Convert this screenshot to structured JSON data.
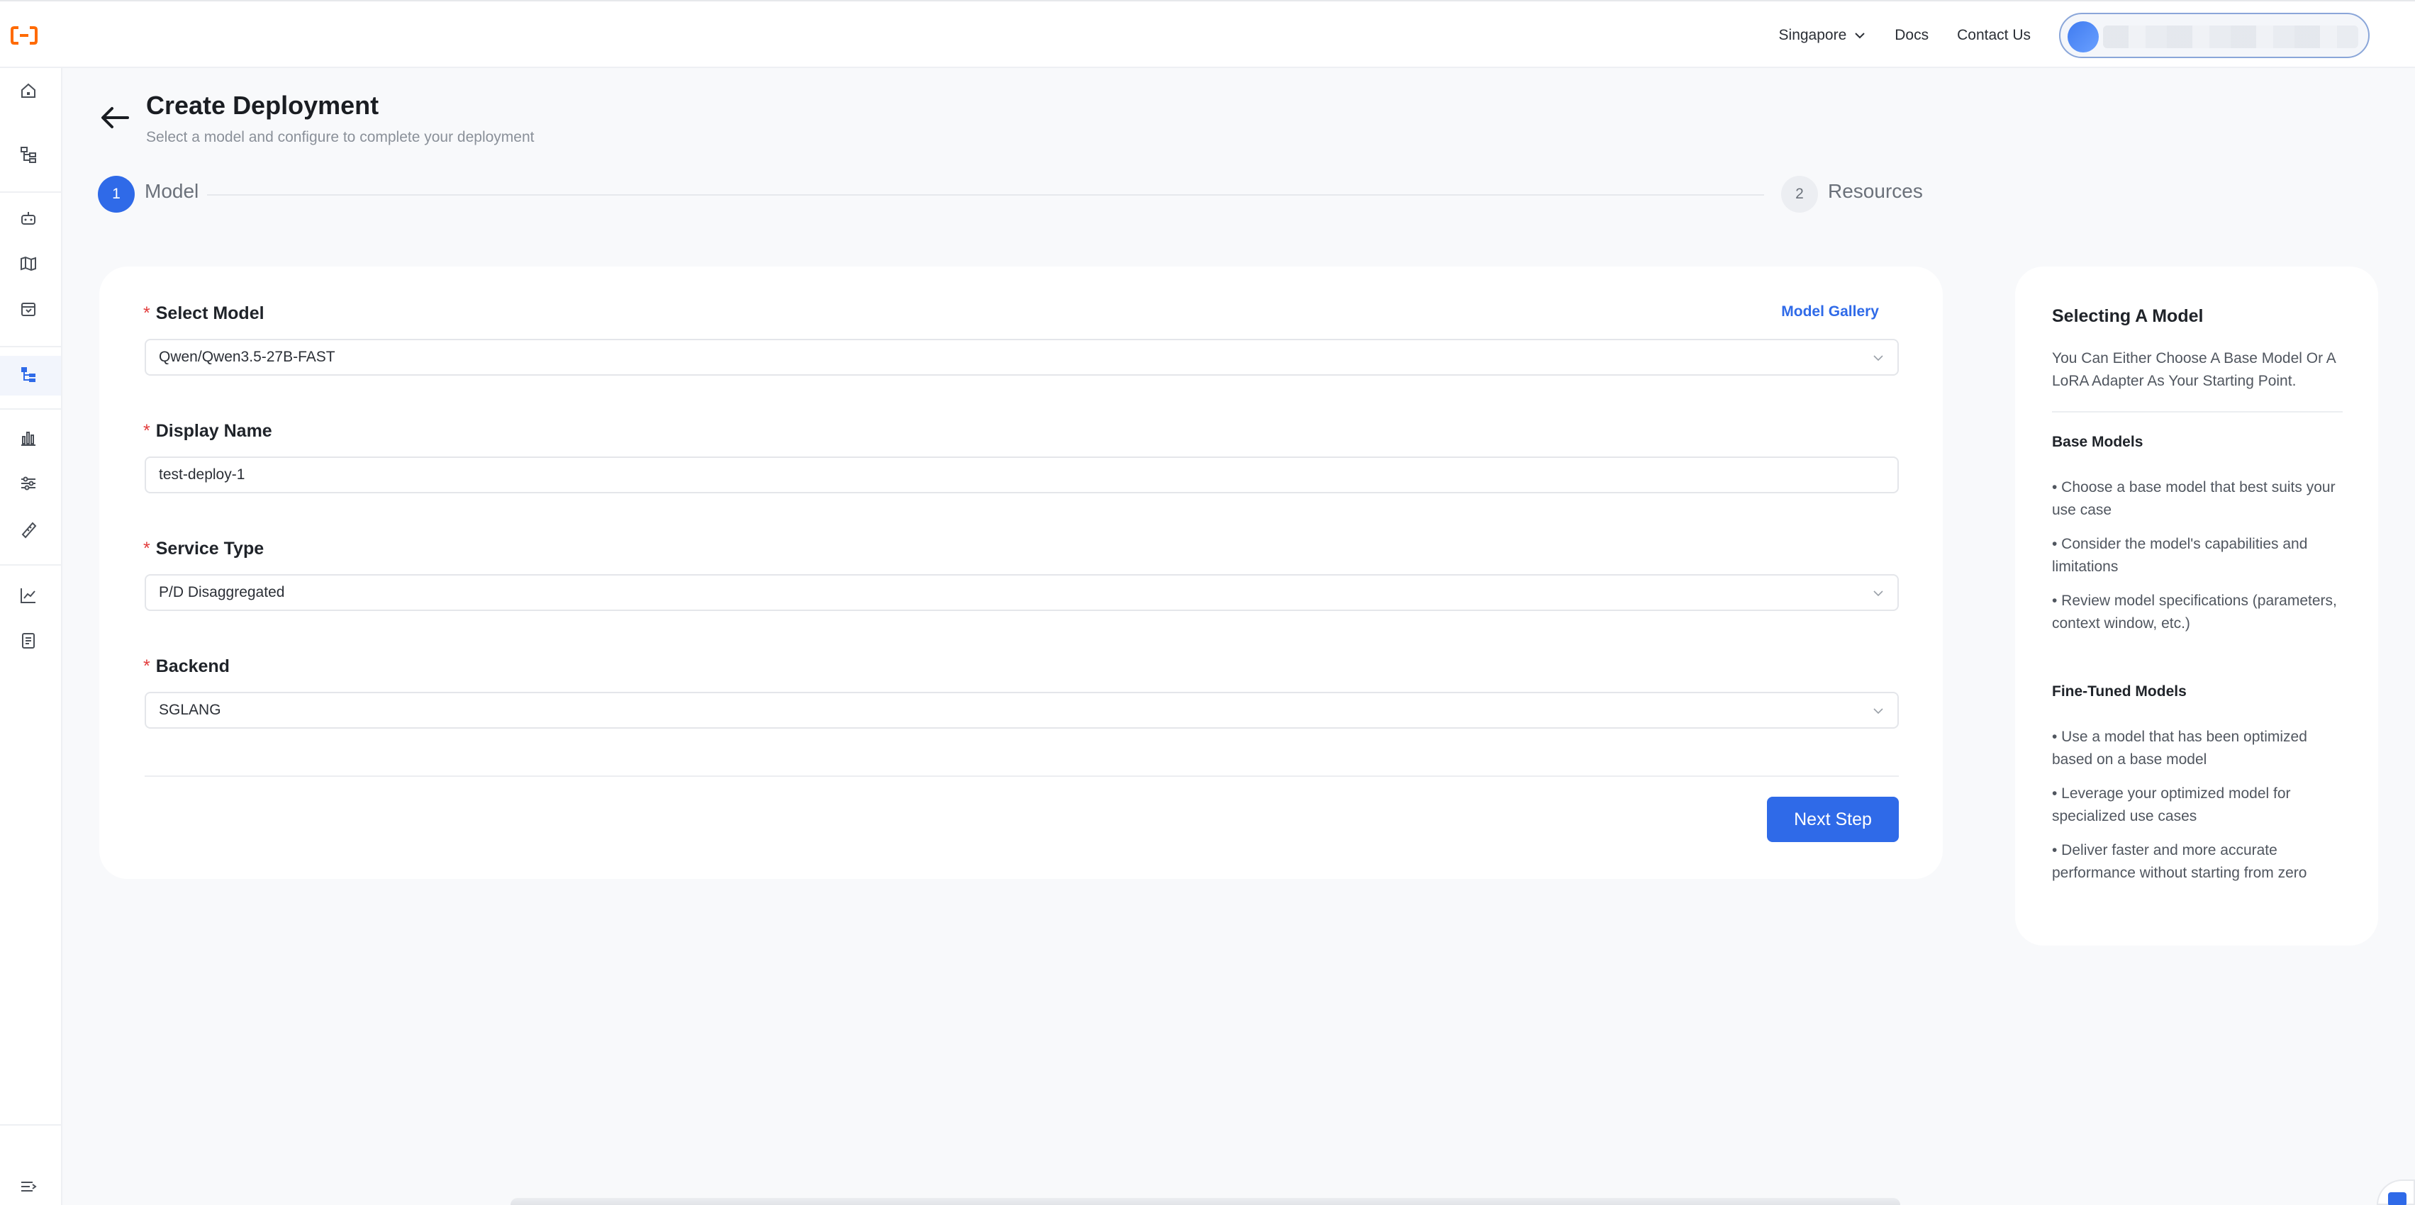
{
  "topbar": {
    "logo_icon": "alibaba-cloud-logo-icon",
    "region": "Singapore",
    "docs": "Docs",
    "contact": "Contact Us"
  },
  "sidebar": {
    "active_item": "deployments",
    "icons": [
      "home-icon",
      "hierarchy-icon",
      "robot-icon",
      "map-icon",
      "box-icon",
      "deployments-icon",
      "bar-chart-icon",
      "sliders-icon",
      "ruler-icon",
      "line-chart-icon",
      "document-icon",
      "collapse-menu-icon"
    ]
  },
  "header": {
    "title": "Create Deployment",
    "subtitle": "Select a model and configure to complete your deployment"
  },
  "stepper": {
    "steps": [
      {
        "number": "1",
        "label": "Model",
        "active": true
      },
      {
        "number": "2",
        "label": "Resources",
        "active": false
      }
    ]
  },
  "form": {
    "required_marker": "*",
    "select_model": {
      "label": "Select Model",
      "value": "Qwen/Qwen3.5-27B-FAST"
    },
    "model_gallery": "Model Gallery",
    "display_name": {
      "label": "Display Name",
      "value": "test-deploy-1"
    },
    "service_type": {
      "label": "Service Type",
      "value": "P/D Disaggregated"
    },
    "backend": {
      "label": "Backend",
      "value": "SGLANG"
    },
    "next_button": "Next Step"
  },
  "help": {
    "title": "Selecting A Model",
    "intro": "You Can Either Choose A Base Model Or A LoRA Adapter As Your Starting Point.",
    "base_heading": "Base Models",
    "base_items": [
      "• Choose a base model that best suits your use case",
      "• Consider the model's capabilities and limitations",
      "• Review model specifications (parameters, context window, etc.)"
    ],
    "fine_heading": "Fine-Tuned Models",
    "fine_items": [
      "• Use a model that has been optimized based on a base model",
      "• Leverage your optimized model for specialized use cases",
      "• Deliver faster and more accurate performance without starting from zero"
    ]
  },
  "colors": {
    "accent": "#2f6ae8",
    "required": "#e23c3c",
    "background": "#f8f9fb"
  }
}
